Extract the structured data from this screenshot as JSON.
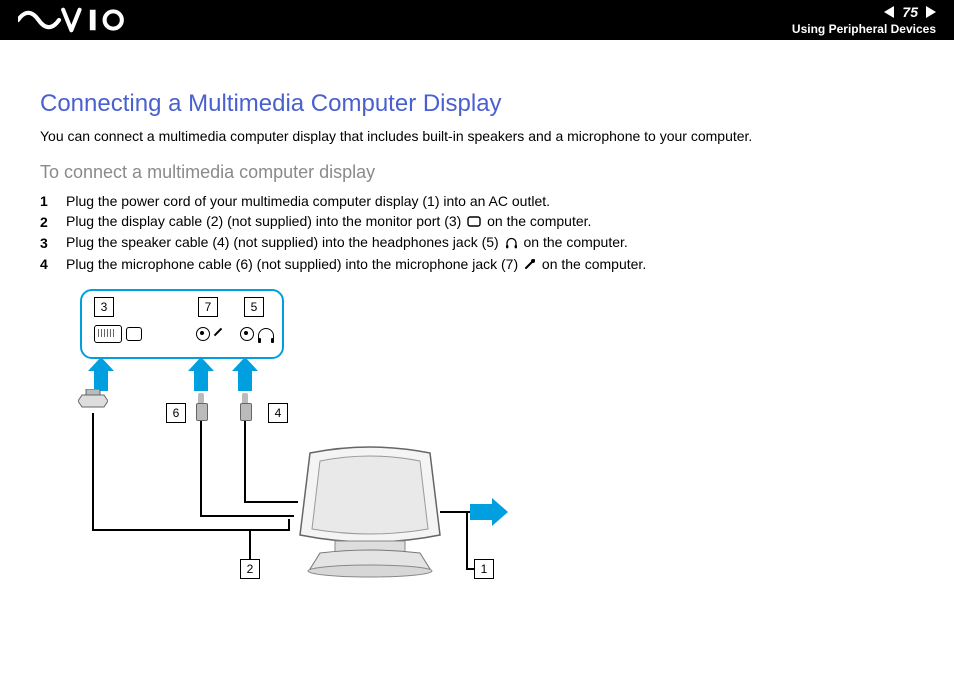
{
  "page_number": "75",
  "section_title": "Using Peripheral Devices",
  "title": "Connecting a Multimedia Computer Display",
  "intro": "You can connect a multimedia computer display that includes built-in speakers and a microphone to your computer.",
  "subhead": "To connect a multimedia computer display",
  "steps": [
    {
      "n": "1",
      "text_a": "Plug the power cord of your multimedia computer display (1) into an AC outlet.",
      "icon": ""
    },
    {
      "n": "2",
      "text_a": "Plug the display cable (2) (not supplied) into the monitor port (3) ",
      "icon": "monitor-port-icon",
      "text_b": " on the computer."
    },
    {
      "n": "3",
      "text_a": "Plug the speaker cable (4) (not supplied) into the headphones jack (5) ",
      "icon": "headphones-icon",
      "text_b": " on the computer."
    },
    {
      "n": "4",
      "text_a": "Plug the microphone cable (6) (not supplied) into the microphone jack (7) ",
      "icon": "microphone-icon",
      "text_b": " on the computer."
    }
  ],
  "callouts": {
    "c1": "1",
    "c2": "2",
    "c3": "3",
    "c4": "4",
    "c5": "5",
    "c6": "6",
    "c7": "7"
  }
}
